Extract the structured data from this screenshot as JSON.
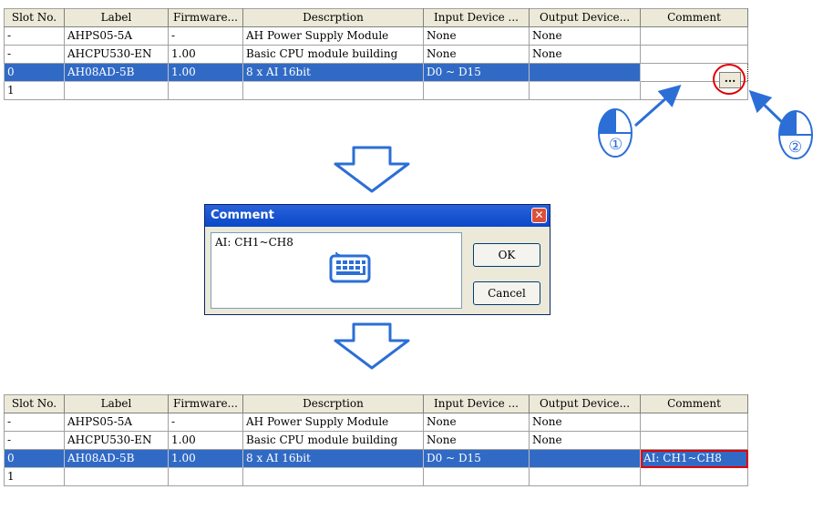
{
  "columns": [
    "Slot No.",
    "Label",
    "Firmware...",
    "Descrption",
    "Input Device ...",
    "Output Device...",
    "Comment"
  ],
  "table_before": [
    {
      "slot": "-",
      "label": "AHPS05-5A",
      "firmware": "-",
      "description": "AH Power Supply Module",
      "input": "None",
      "output": "None",
      "comment": ""
    },
    {
      "slot": "-",
      "label": "AHCPU530-EN",
      "firmware": "1.00",
      "description": "Basic CPU module building",
      "input": "None",
      "output": "None",
      "comment": ""
    },
    {
      "slot": "0",
      "label": "AH08AD-5B",
      "firmware": "1.00",
      "description": "8 x AI 16bit",
      "input": "D0 ~ D15",
      "output": "",
      "comment": ""
    },
    {
      "slot": "1",
      "label": "",
      "firmware": "",
      "description": "",
      "input": "",
      "output": "",
      "comment": ""
    }
  ],
  "table_after": [
    {
      "slot": "-",
      "label": "AHPS05-5A",
      "firmware": "-",
      "description": "AH Power Supply Module",
      "input": "None",
      "output": "None",
      "comment": ""
    },
    {
      "slot": "-",
      "label": "AHCPU530-EN",
      "firmware": "1.00",
      "description": "Basic CPU module building",
      "input": "None",
      "output": "None",
      "comment": ""
    },
    {
      "slot": "0",
      "label": "AH08AD-5B",
      "firmware": "1.00",
      "description": "8 x AI 16bit",
      "input": "D0 ~ D15",
      "output": "",
      "comment": "AI: CH1~CH8"
    },
    {
      "slot": "1",
      "label": "",
      "firmware": "",
      "description": "",
      "input": "",
      "output": "",
      "comment": ""
    }
  ],
  "ellipsis_button": "...",
  "step_markers": [
    "①",
    "②"
  ],
  "dialog": {
    "title": "Comment",
    "close": "✕",
    "text": "AI: CH1~CH8",
    "ok_label": "OK",
    "cancel_label": "Cancel"
  },
  "colors": {
    "selection": "#316ac5",
    "highlight": "#e00000",
    "arrow_blue": "#2b6fd6",
    "title_blue": "#0a48c8"
  }
}
